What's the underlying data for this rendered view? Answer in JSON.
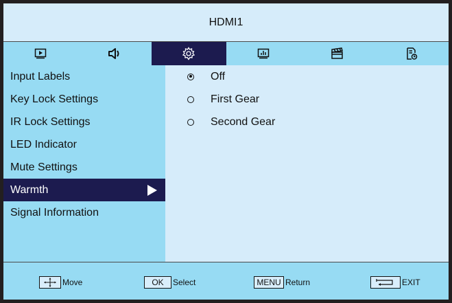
{
  "header": {
    "title": "HDMI1"
  },
  "tabs": [
    {
      "icon": "play-icon",
      "active": false
    },
    {
      "icon": "speaker-icon",
      "active": false
    },
    {
      "icon": "gear-icon",
      "active": true
    },
    {
      "icon": "chart-icon",
      "active": false
    },
    {
      "icon": "clapperboard-icon",
      "active": false
    },
    {
      "icon": "document-clock-icon",
      "active": false
    }
  ],
  "menu": {
    "items": [
      {
        "label": "Input Labels"
      },
      {
        "label": "Key Lock Settings"
      },
      {
        "label": "IR Lock Settings"
      },
      {
        "label": "LED Indicator"
      },
      {
        "label": "Mute Settings"
      },
      {
        "label": "Warmth"
      },
      {
        "label": "Signal Information"
      }
    ],
    "selected": "Warmth"
  },
  "options": [
    {
      "label": "Off",
      "checked": true
    },
    {
      "label": "First Gear",
      "checked": false
    },
    {
      "label": "Second Gear",
      "checked": false
    }
  ],
  "footer": {
    "move": {
      "key_icon": "dpad-icon",
      "label": "Move"
    },
    "select": {
      "key": "OK",
      "label": "Select"
    },
    "return": {
      "key": "MENU",
      "label": "Return"
    },
    "exit": {
      "key_icon": "return-arrow-icon",
      "label": "EXIT"
    }
  },
  "colors": {
    "title_bg": "#d6ecfa",
    "panel_bg": "#97dbf3",
    "highlight": "#1c1b4f",
    "border": "#231f20"
  }
}
